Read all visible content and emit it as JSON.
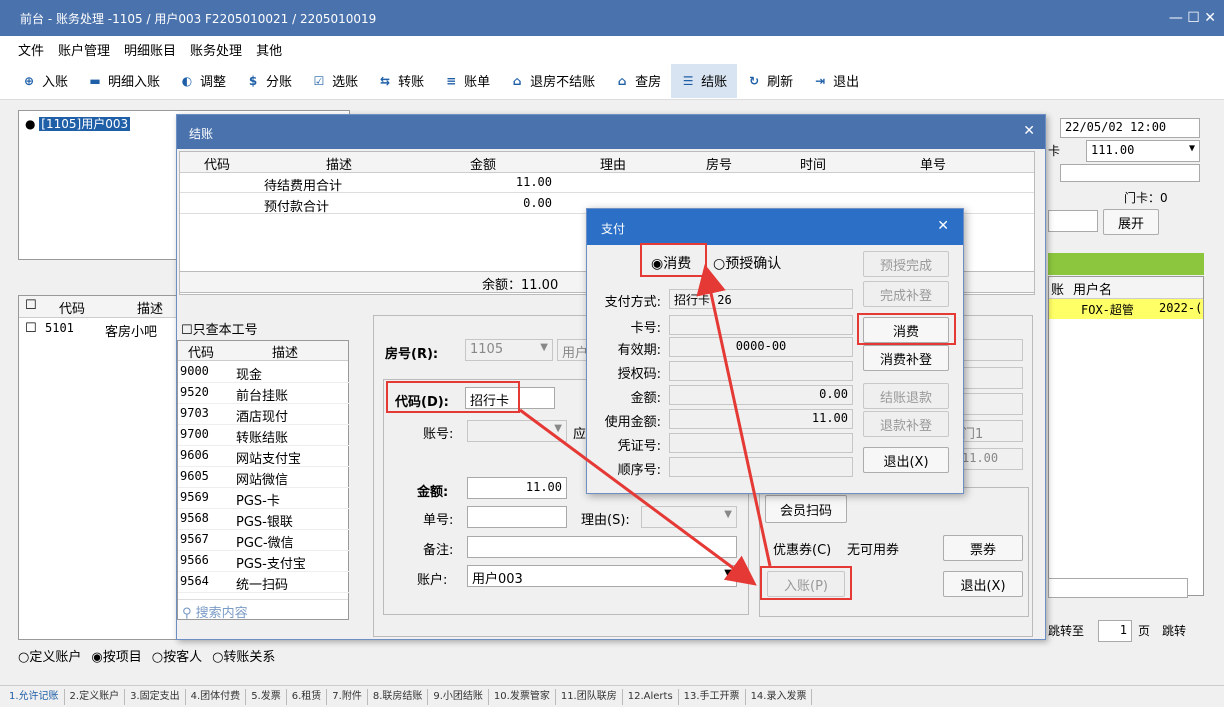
{
  "window": {
    "title": "前台 - 账务处理 -1105 / 用户003 F2205010021 / 2205010019",
    "controls": "—  ☐  ✕"
  },
  "menu": [
    "文件",
    "账户管理",
    "明细账目",
    "账务处理",
    "其他"
  ],
  "toolbar": [
    {
      "label": "入账",
      "icon": "circle-plus-icon"
    },
    {
      "label": "明细入账",
      "icon": "detail-icon"
    },
    {
      "label": "调整",
      "icon": "adjust-icon"
    },
    {
      "label": "分账",
      "icon": "split-icon"
    },
    {
      "label": "选账",
      "icon": "select-icon"
    },
    {
      "label": "转账",
      "icon": "transfer-icon"
    },
    {
      "label": "账单",
      "icon": "bill-icon"
    },
    {
      "label": "退房不结账",
      "icon": "checkout-icon"
    },
    {
      "label": "查房",
      "icon": "inspect-icon"
    },
    {
      "label": "结账",
      "icon": "settle-icon"
    },
    {
      "label": "刷新",
      "icon": "refresh-icon"
    },
    {
      "label": "退出",
      "icon": "exit-icon"
    }
  ],
  "tree": {
    "node": "[1105]用户003"
  },
  "left_grid": {
    "headers": [
      "代码",
      "描述"
    ],
    "rows": [
      [
        "5101",
        "客房小吧"
      ]
    ]
  },
  "radio_bar": [
    "定义账户",
    "按项目",
    "按客人",
    "转账关系"
  ],
  "right": {
    "datetime": "22/05/02 12:00",
    "amount": "111.00",
    "door": "门卡：0",
    "expand": "展开",
    "hdr1": "账",
    "hdr2": "用户名",
    "user": "FOX-超管",
    "date": "2022-(",
    "jump_label": "跳转至",
    "page": "1",
    "page_unit": "页",
    "jump_btn": "跳转",
    "kakou": "卡"
  },
  "settle": {
    "title": "结账",
    "headers": [
      "代码",
      "描述",
      "金额",
      "理由",
      "房号",
      "时间",
      "单号"
    ],
    "rows": [
      [
        "",
        "待结费用合计",
        "11.00"
      ],
      [
        "",
        "预付款合计",
        "0.00"
      ]
    ],
    "balance": "余额：11.00",
    "only_mine": "只查本工号",
    "pay_headers": [
      "代码",
      "描述"
    ],
    "pay_list": [
      [
        "9000",
        "现金"
      ],
      [
        "9520",
        "前台挂账"
      ],
      [
        "9703",
        "酒店现付"
      ],
      [
        "9700",
        "转账结账"
      ],
      [
        "9606",
        "网站支付宝"
      ],
      [
        "9605",
        "网站微信"
      ],
      [
        "9569",
        "PGS-卡"
      ],
      [
        "9568",
        "PGS-银联"
      ],
      [
        "9567",
        "PGC-微信"
      ],
      [
        "9566",
        "PGS-支付宝"
      ],
      [
        "9564",
        "统一扫码"
      ]
    ],
    "search_placeholder": "搜索内容",
    "room_label": "房号(R):",
    "room_value": "1105",
    "room_user": "用户",
    "code_label": "代码(D):",
    "code_value": "招行卡",
    "account_label": "账号:",
    "ying": "应",
    "amount_label": "金额:",
    "amount_value": "11.00",
    "bill_label": "单号:",
    "reason_label": "理由(S):",
    "remark_label": "备注:",
    "acct_label": "账户:",
    "acct_value": "用户003",
    "member_btn": "会员扫码",
    "coupon_label": "优惠券(C)",
    "coupon_value": "无可用券",
    "ticket_btn": "票券",
    "post_btn": "入账(P)",
    "exit_btn": "退出(X)",
    "partial1": "门1",
    "partial2": "11.00"
  },
  "pay": {
    "title": "支付",
    "opt1": "消费",
    "opt2": "预授确认",
    "fields": [
      [
        "支付方式:",
        "招行卡 26"
      ],
      [
        "卡号:",
        ""
      ],
      [
        "有效期:",
        "0000-00"
      ],
      [
        "授权码:",
        ""
      ],
      [
        "金额:",
        "0.00"
      ],
      [
        "使用金额:",
        "11.00"
      ],
      [
        "凭证号:",
        ""
      ],
      [
        "顺序号:",
        ""
      ]
    ],
    "buttons": [
      "预授完成",
      "完成补登",
      "消费",
      "消费补登",
      "结账退款",
      "退款补登",
      "退出(X)"
    ]
  },
  "statusbar": [
    "1.允许记账",
    "2.定义账户",
    "3.固定支出",
    "4.团体付费",
    "5.发票",
    "6.租赁",
    "7.附件",
    "8.联房结账",
    "9.小团结账",
    "10.发票管家",
    "11.团队联房",
    "12.Alerts",
    "13.手工开票",
    "14.录入发票"
  ]
}
